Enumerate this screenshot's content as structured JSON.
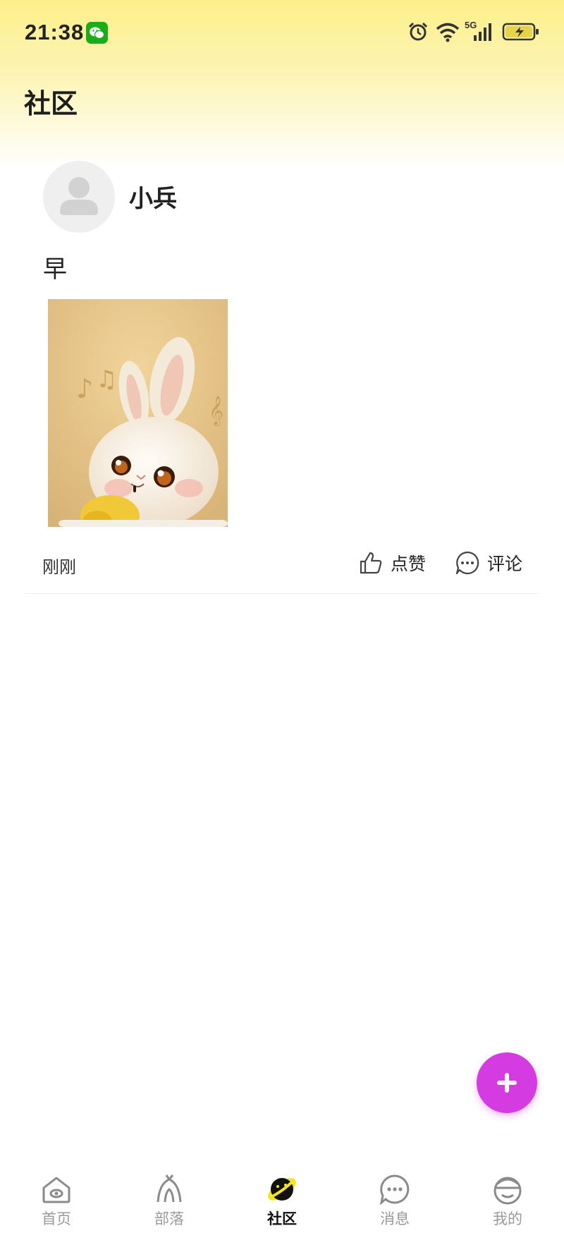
{
  "status_bar": {
    "time": "21:38",
    "network_label": "5G",
    "icons": [
      "wechat-icon",
      "alarm-icon",
      "wifi-icon",
      "signal-icon",
      "battery-charging-icon"
    ]
  },
  "header": {
    "title": "社区"
  },
  "post": {
    "author": "小兵",
    "text": "早",
    "image": "cartoon-bunny-image",
    "time": "刚刚",
    "like_label": "点赞",
    "comment_label": "评论"
  },
  "fab": {
    "icon": "plus-icon",
    "color": "#d43be0"
  },
  "tabbar": {
    "tabs": [
      {
        "label": "首页",
        "icon": "home-icon",
        "active": false
      },
      {
        "label": "部落",
        "icon": "tribe-icon",
        "active": false
      },
      {
        "label": "社区",
        "icon": "planet-icon",
        "active": true
      },
      {
        "label": "消息",
        "icon": "message-icon",
        "active": false
      },
      {
        "label": "我的",
        "icon": "profile-icon",
        "active": false
      }
    ]
  },
  "colors": {
    "header_gradient": "#fdf08a",
    "accent": "#d43be0",
    "active_tab_icon": "#f5e61c"
  }
}
